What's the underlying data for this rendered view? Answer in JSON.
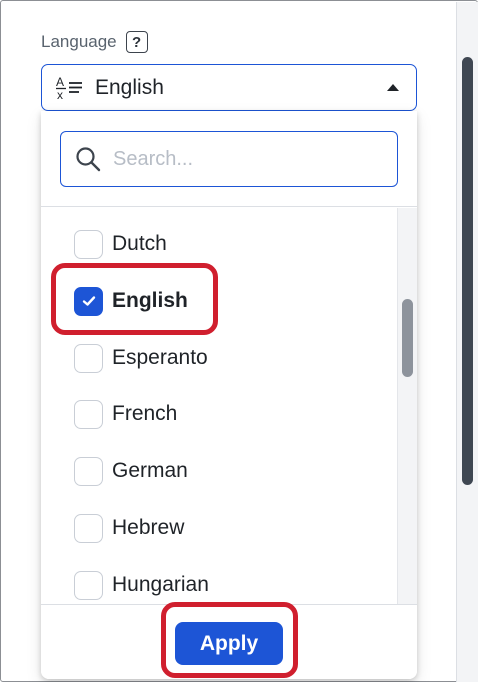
{
  "language_field": {
    "label": "Language",
    "help_glyph": "?",
    "selected_value": "English",
    "icon": "translate-icon",
    "caret": "caret-up-icon"
  },
  "search": {
    "placeholder": "Search...",
    "value": "",
    "icon": "search-icon"
  },
  "languages": [
    {
      "label": "Dutch",
      "checked": false
    },
    {
      "label": "English",
      "checked": true
    },
    {
      "label": "Esperanto",
      "checked": false
    },
    {
      "label": "French",
      "checked": false
    },
    {
      "label": "German",
      "checked": false
    },
    {
      "label": "Hebrew",
      "checked": false
    },
    {
      "label": "Hungarian",
      "checked": false
    }
  ],
  "footer": {
    "apply_label": "Apply"
  },
  "colors": {
    "accent": "#1d55d6",
    "highlight": "#d01f2e"
  }
}
